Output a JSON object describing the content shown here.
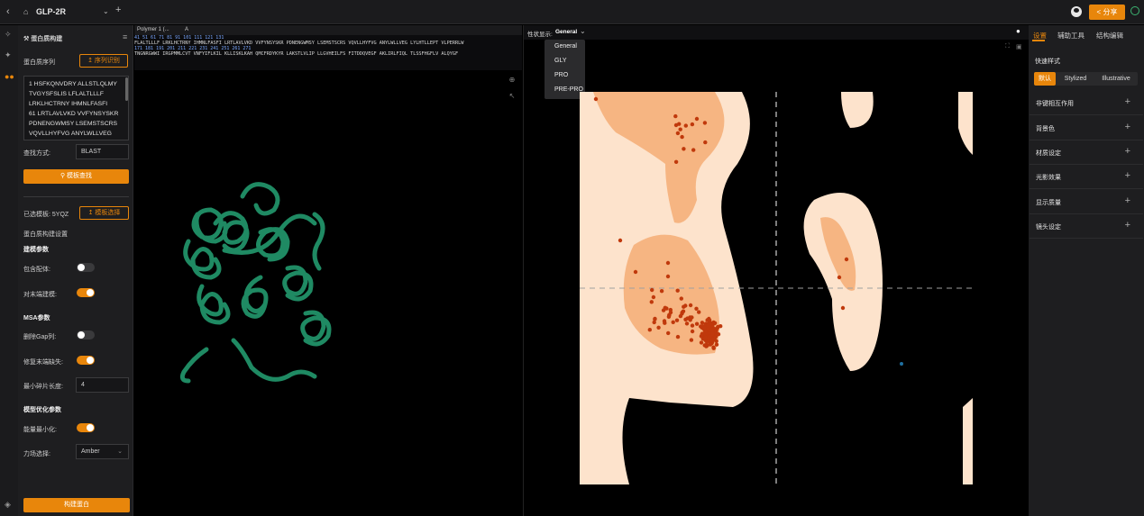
{
  "topbar": {
    "back_icon": "chevron-left-icon",
    "home_icon": "home-icon",
    "project_name": "GLP-2R",
    "share_label": "分享",
    "colors": {
      "accent": "#e8860b",
      "ok": "#3cb371"
    }
  },
  "left_panel": {
    "title": "蛋白质构建",
    "sequence_label": "蛋白质序列",
    "sequence_button": "序列识别",
    "sequence_lines": [
      "1    HSFKQNVDRY ALLSTLQLMY",
      "TVGYSFSLIS LFLALTLLLF",
      "LRKLHCTRNY IHMNLFASFI",
      "61    LRTLAVLVKD VVFYNSYSKR",
      "PDNENGWMSY LSEMSTSCRS",
      "VQVLLHYFVG ANYLWLLVEG"
    ],
    "search_method_label": "查找方式:",
    "search_method_value": "BLAST",
    "template_search_button": "模板查找",
    "selected_template_label": "已选模板: 5YQZ",
    "template_select_button": "模板选择",
    "build_settings_label": "蛋白质构建设置",
    "modeling_params_label": "建模参数",
    "include_ligand_label": "包含配体:",
    "include_ligand": false,
    "auto_fill_label": "对末端建模:",
    "auto_fill": true,
    "msa_params_label": "MSA参数",
    "remove_gap_label": "删除Gap列:",
    "remove_gap": false,
    "repair_terminal_label": "修复末端缺失:",
    "repair_terminal": true,
    "min_fragment_label": "最小碎片长度:",
    "min_fragment_value": "4",
    "model_opt_label": "模型优化参数",
    "energy_min_label": "能量最小化:",
    "energy_min": true,
    "forcefield_label": "力场选择:",
    "forcefield_value": "Amber",
    "build_button": "构建蛋白"
  },
  "sequence_viewer": {
    "tab_name": "Polymer 1 (...",
    "chain": "A",
    "numbers_row1": "        41        51        61        71        81        91        101       111       121       131",
    "line1": "FLALTLLLF LRKLHCTRNY IHMNLFASFI LRTLAVLVKD VVFYNSYSKR PDNENGWMSY LSEMSTSCRS VQVLLHYFVG ANYLWLLVEG LYLHTLLEPT VLPERRLW",
    "numbers_row2": "171       181       191       201       211       221       231       241       251       261       271",
    "line2": "TNGNRGWWI IRGPMMLCVT VNFYIFLKIL KLLISKLKAH QMCFRDYKYR LAKSTLVLIP LLGVHEILFS FITDDQVEGF AKLIRLFIQL TLSSFHGFLV ALQYGF"
  },
  "ramachandran": {
    "display_label": "性状显示:",
    "display_value": "General",
    "options": [
      "General",
      "GLY",
      "PRO",
      "PRE-PRO"
    ],
    "colors": {
      "favored": "#f6b582",
      "allowed": "#fde3cc",
      "points": "#c0390c"
    }
  },
  "right_panel": {
    "tabs": [
      "设置",
      "辅助工具",
      "结构编辑"
    ],
    "quick_style_label": "快速样式",
    "styles": [
      "默认",
      "Stylized",
      "Illustrative"
    ],
    "sections": [
      "非键相互作用",
      "背景色",
      "材质设定",
      "光影效果",
      "显示质量",
      "镜头设定"
    ]
  }
}
